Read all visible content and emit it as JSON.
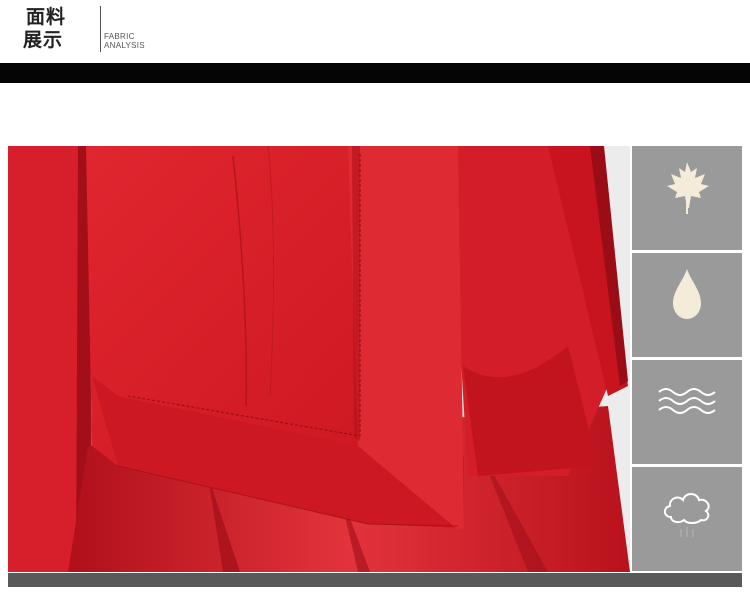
{
  "header": {
    "title_cn_line1": "面料",
    "title_cn_line2": "展示",
    "title_en_line1": "FABRIC",
    "title_en_line2": "ANALYSIS"
  },
  "photo": {
    "subject": "red-fabric-garment-closeup",
    "colors": {
      "main": "#d8222d",
      "dark": "#a8121c",
      "light": "#ea3a44"
    }
  },
  "sidebar": {
    "panels": [
      {
        "icon": "maple-leaf-icon",
        "caption": ""
      },
      {
        "icon": "water-drop-icon",
        "caption": ""
      },
      {
        "icon": "waves-icon",
        "caption": ""
      },
      {
        "icon": "cloud-icon",
        "caption": ""
      }
    ],
    "colors": {
      "panel_bg": "#9a9a9a",
      "icon_fill": "#f4ecd8",
      "icon_stroke": "#ffffff"
    }
  },
  "colors": {
    "header_bar": "#050505",
    "bottom_bar": "#595959"
  }
}
